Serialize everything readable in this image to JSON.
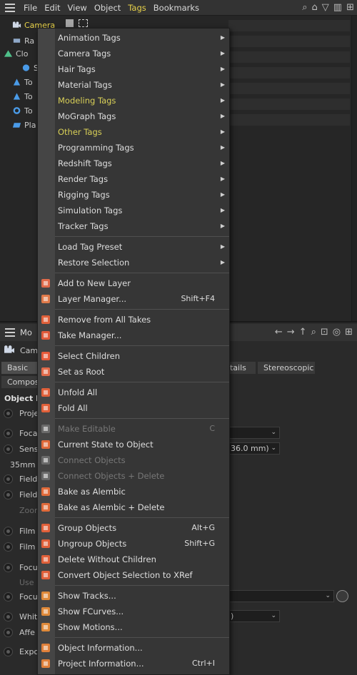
{
  "menubar": {
    "items": [
      "File",
      "Edit",
      "View",
      "Object",
      "Tags",
      "Bookmarks"
    ],
    "active": "Tags"
  },
  "objects": {
    "items": [
      {
        "label": "Camera"
      },
      {
        "label": "Ra"
      },
      {
        "label": "Clo"
      },
      {
        "label": "S"
      },
      {
        "label": "To"
      },
      {
        "label": "To"
      },
      {
        "label": "To"
      },
      {
        "label": "Pla"
      }
    ]
  },
  "attributes": {
    "header": "Mo",
    "object": "Cam",
    "tabs": [
      "Basic",
      "tails",
      "Stereoscopic"
    ],
    "tab2": "Composi",
    "section": "Object P",
    "rows": [
      "Proje",
      "Foca",
      "Sens",
      "35mm",
      "Field",
      "Field",
      "Zoom",
      "Film",
      "Film",
      "Focu",
      "Use",
      "Focu",
      "Whit",
      "Affe",
      "Expo"
    ],
    "sensor_field": "36.0 mm)",
    "white_field": ")"
  },
  "context_menu": {
    "groups": [
      [
        {
          "label": "Animation Tags",
          "submenu": true
        },
        {
          "label": "Camera Tags",
          "submenu": true
        },
        {
          "label": "Hair Tags",
          "submenu": true
        },
        {
          "label": "Material Tags",
          "submenu": true
        },
        {
          "label": "Modeling Tags",
          "submenu": true,
          "highlight": true
        },
        {
          "label": "MoGraph Tags",
          "submenu": true
        },
        {
          "label": "Other Tags",
          "submenu": true,
          "highlight": true
        },
        {
          "label": "Programming Tags",
          "submenu": true
        },
        {
          "label": "Redshift Tags",
          "submenu": true
        },
        {
          "label": "Render Tags",
          "submenu": true
        },
        {
          "label": "Rigging Tags",
          "submenu": true
        },
        {
          "label": "Simulation Tags",
          "submenu": true
        },
        {
          "label": "Tracker Tags",
          "submenu": true
        }
      ],
      [
        {
          "label": "Load Tag Preset",
          "submenu": true
        },
        {
          "label": "Restore Selection",
          "submenu": true
        }
      ],
      [
        {
          "label": "Add to New Layer",
          "icon": "layer-add-icon"
        },
        {
          "label": "Layer Manager...",
          "shortcut": "Shift+F4",
          "icon": "layer-manager-icon"
        }
      ],
      [
        {
          "label": "Remove from All Takes",
          "icon": "takes-remove-icon"
        },
        {
          "label": "Take Manager...",
          "icon": "take-manager-icon"
        }
      ],
      [
        {
          "label": "Select Children",
          "icon": "select-children-icon"
        },
        {
          "label": "Set as Root",
          "icon": "set-root-icon"
        }
      ],
      [
        {
          "label": "Unfold All",
          "icon": "unfold-icon"
        },
        {
          "label": "Fold All",
          "icon": "fold-icon"
        }
      ],
      [
        {
          "label": "Make Editable",
          "shortcut": "C",
          "disabled": true,
          "icon": "make-editable-icon"
        },
        {
          "label": "Current State to Object",
          "icon": "current-state-icon"
        },
        {
          "label": "Connect Objects",
          "disabled": true,
          "icon": "connect-icon"
        },
        {
          "label": "Connect Objects + Delete",
          "disabled": true,
          "icon": "connect-delete-icon"
        },
        {
          "label": "Bake as Alembic",
          "icon": "alembic-icon"
        },
        {
          "label": "Bake as Alembic + Delete",
          "icon": "alembic-delete-icon"
        }
      ],
      [
        {
          "label": "Group Objects",
          "shortcut": "Alt+G",
          "icon": "group-icon"
        },
        {
          "label": "Ungroup Objects",
          "shortcut": "Shift+G",
          "icon": "ungroup-icon"
        },
        {
          "label": "Delete Without Children",
          "icon": "delete-icon"
        },
        {
          "label": "Convert Object Selection to XRef",
          "icon": "xref-icon"
        }
      ],
      [
        {
          "label": "Show Tracks...",
          "icon": "tracks-icon"
        },
        {
          "label": "Show FCurves...",
          "icon": "fcurves-icon"
        },
        {
          "label": "Show Motions...",
          "icon": "motions-icon"
        }
      ],
      [
        {
          "label": "Object Information...",
          "icon": "info-icon"
        },
        {
          "label": "Project Information...",
          "shortcut": "Ctrl+I",
          "icon": "project-info-icon"
        }
      ]
    ]
  }
}
